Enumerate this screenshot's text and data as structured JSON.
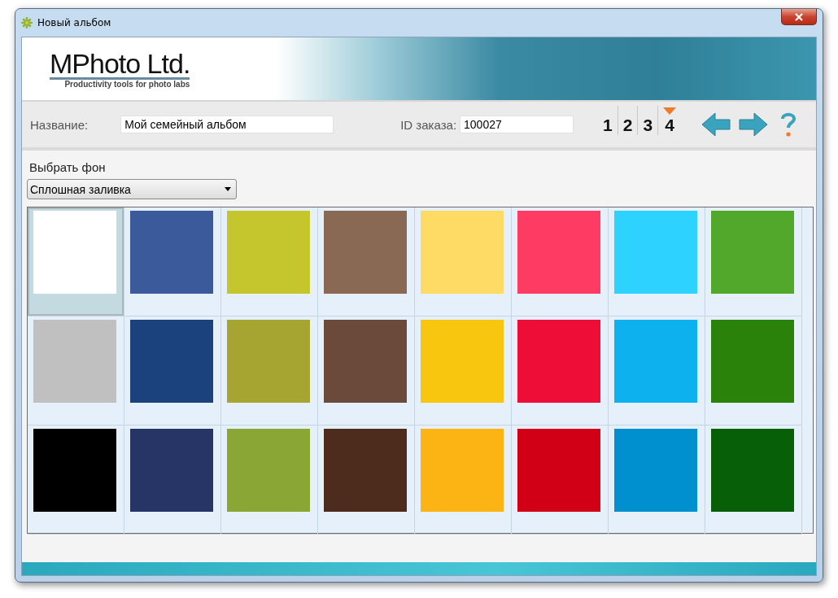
{
  "window": {
    "title": "Новый альбом"
  },
  "logo": {
    "name": "MPhoto Ltd.",
    "tagline": "Productivity tools for photo labs"
  },
  "form": {
    "name_label": "Название:",
    "name_value": "Мой семейный альбом",
    "order_label": "ID заказа:",
    "order_value": "100027"
  },
  "steps": [
    {
      "label": "1",
      "selected": false
    },
    {
      "label": "2",
      "selected": false
    },
    {
      "label": "3",
      "selected": false
    },
    {
      "label": "4",
      "selected": true
    }
  ],
  "background": {
    "label": "Выбрать фон",
    "dropdown": "Сплошная заливка"
  },
  "swatches": [
    {
      "color": "#ffffff",
      "selected": true
    },
    {
      "color": "#3a5a9c",
      "selected": false
    },
    {
      "color": "#c5c52e",
      "selected": false
    },
    {
      "color": "#8a6954",
      "selected": false
    },
    {
      "color": "#fedb64",
      "selected": false
    },
    {
      "color": "#fe3b62",
      "selected": false
    },
    {
      "color": "#2ed2fe",
      "selected": false
    },
    {
      "color": "#52a82a",
      "selected": false
    },
    {
      "color": "#c0c0c0",
      "selected": false
    },
    {
      "color": "#1c427d",
      "selected": false
    },
    {
      "color": "#a6a532",
      "selected": false
    },
    {
      "color": "#6c4a3b",
      "selected": false
    },
    {
      "color": "#f8c60f",
      "selected": false
    },
    {
      "color": "#ee0d36",
      "selected": false
    },
    {
      "color": "#0cb1ee",
      "selected": false
    },
    {
      "color": "#2a820a",
      "selected": false
    },
    {
      "color": "#000000",
      "selected": false
    },
    {
      "color": "#263466",
      "selected": false
    },
    {
      "color": "#8aa634",
      "selected": false
    },
    {
      "color": "#4d2b1d",
      "selected": false
    },
    {
      "color": "#fcb414",
      "selected": false
    },
    {
      "color": "#d20016",
      "selected": false
    },
    {
      "color": "#0090cf",
      "selected": false
    },
    {
      "color": "#075f07",
      "selected": false
    }
  ]
}
